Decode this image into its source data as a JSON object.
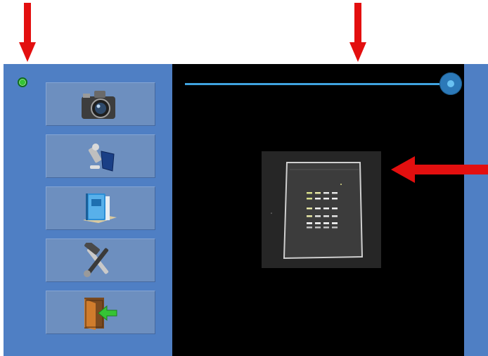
{
  "annotations": {
    "arrow_color": "#e30f0f"
  },
  "colors": {
    "app_background": "#4f7fc4",
    "button_background": "#6d8fbf",
    "viewer_background": "#000000",
    "slider_color": "#3fa3df",
    "status_indicator": "#35c435"
  },
  "sidebar": {
    "status_indicator": {
      "state": "ok"
    },
    "buttons": [
      {
        "icon": "camera-icon"
      },
      {
        "icon": "lamp-icon"
      },
      {
        "icon": "book-icon"
      },
      {
        "icon": "tools-icon"
      },
      {
        "icon": "exit-door-icon"
      }
    ]
  },
  "viewer": {
    "exposure_slider": {
      "value_fraction": 1.0
    },
    "image": {
      "content": "gel-electrophoresis"
    }
  }
}
